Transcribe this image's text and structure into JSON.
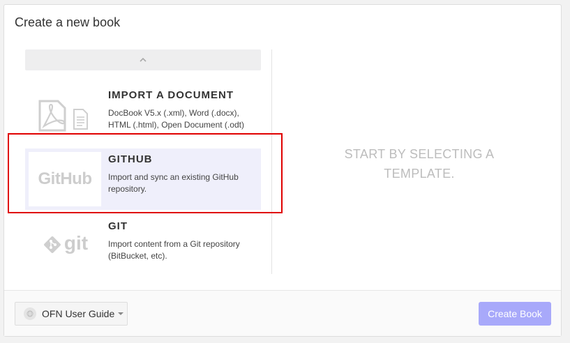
{
  "dialog": {
    "title": "Create a new book"
  },
  "templates": [
    {
      "name": "IMPORT A DOCUMENT",
      "description": "DocBook V5.x (.xml), Word (.docx), HTML (.html), Open Document (.odt)",
      "icon": "pdf-document-icon"
    },
    {
      "name": "GITHUB",
      "description": "Import and sync an existing GitHub repository.",
      "icon": "github-logo",
      "logo_text": "GitHub",
      "selected": true
    },
    {
      "name": "GIT",
      "description": "Import content from a Git repository (BitBucket, etc).",
      "icon": "git-logo",
      "logo_text": "git"
    }
  ],
  "preview": {
    "placeholder": "START BY SELECTING A TEMPLATE."
  },
  "footer": {
    "owner": "OFN User Guide",
    "create_label": "Create Book"
  },
  "colors": {
    "selected_bg": "#efeffb",
    "highlight": "#e00000",
    "primary_disabled": "#a8a9fa"
  }
}
